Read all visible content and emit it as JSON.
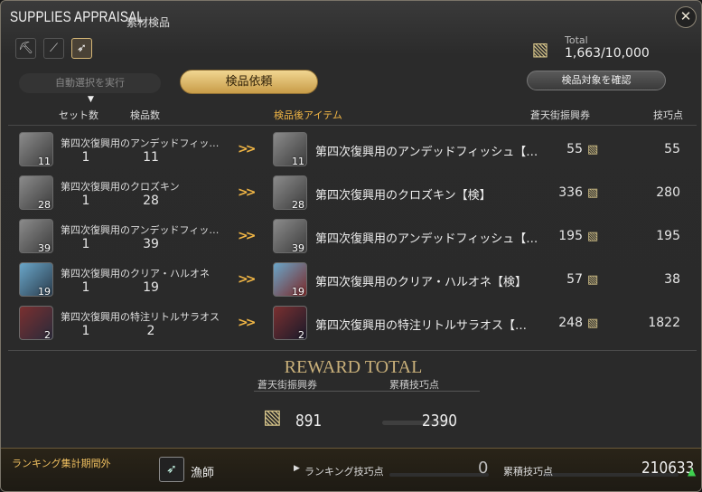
{
  "window": {
    "title": "SUPPLIES APPRAISAL",
    "subtitle": "素材検品",
    "close_icon": "crossed-swords-close-icon"
  },
  "tools": [
    {
      "icon": "pickaxe-icon",
      "glyph": "⛏",
      "selected": false
    },
    {
      "icon": "hatchet-icon",
      "glyph": "🪓",
      "selected": false
    },
    {
      "icon": "fishing-rod-icon",
      "glyph": "🐟",
      "selected": true
    }
  ],
  "buttons": {
    "auto_select": "自動選択を実行",
    "request": "検品依頼",
    "confirm": "検品対象を確認"
  },
  "total": {
    "label": "Total",
    "value": "1,663/10,000",
    "icon": "scrip-icon"
  },
  "headers": {
    "sets": "セット数",
    "count": "検品数",
    "result_item": "検品後アイテム",
    "scrip": "蒼天街振興券",
    "skill": "技巧点"
  },
  "rows": [
    {
      "name": "第四次復興用のアンデッドフィッ…",
      "qty": "11",
      "sets": "1",
      "count": "11",
      "result": "第四次復興用のアンデッドフィッシュ【…",
      "result_qty": "11",
      "scrip": "55",
      "skill": "55"
    },
    {
      "name": "第四次復興用のクロズキン",
      "qty": "28",
      "sets": "1",
      "count": "28",
      "result": "第四次復興用のクロズキン【検】",
      "result_qty": "28",
      "scrip": "336",
      "skill": "280"
    },
    {
      "name": "第四次復興用のアンデッドフィッ…",
      "qty": "39",
      "sets": "1",
      "count": "39",
      "result": "第四次復興用のアンデッドフィッシュ【…",
      "result_qty": "39",
      "scrip": "195",
      "skill": "195"
    },
    {
      "name": "第四次復興用のクリア・ハルオネ",
      "qty": "19",
      "sets": "1",
      "count": "19",
      "result": "第四次復興用のクリア・ハルオネ【検】",
      "result_qty": "19",
      "scrip": "57",
      "skill": "38"
    },
    {
      "name": "第四次復興用の特注リトルサラオス",
      "qty": "2",
      "sets": "1",
      "count": "2",
      "result": "第四次復興用の特注リトルサラオス【…",
      "result_qty": "2",
      "scrip": "248",
      "skill": "1822"
    }
  ],
  "reward": {
    "title": "REWARD TOTAL",
    "scrip_label": "蒼天街振興券",
    "skill_label": "累積技巧点",
    "scrip_total": "891",
    "skill_total": "2390"
  },
  "footer": {
    "rank_status": "ランキング集計期間外",
    "job_icon": "fisher-job-icon",
    "job_name": "漁師",
    "rank_label": "ランキング技巧点",
    "rank_value": "0",
    "acc_label": "累積技巧点",
    "acc_value": "210633",
    "acc_trend_icon": "up-arrow-icon"
  },
  "colors": {
    "accent": "#d5b676",
    "request_button": "#e2c076",
    "trend_up": "#3fcf4f",
    "arrow": "#f0b545"
  }
}
